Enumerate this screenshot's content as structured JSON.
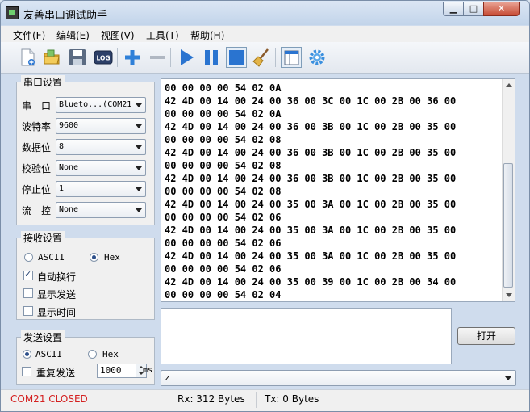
{
  "window": {
    "title": "友善串口调试助手",
    "app_icon": "terminal-icon"
  },
  "window_controls": {
    "minimize": "▁",
    "maximize": "□",
    "close": "✕"
  },
  "menu": [
    "文件(F)",
    "编辑(E)",
    "视图(V)",
    "工具(T)",
    "帮助(H)"
  ],
  "toolbar": {
    "icons": [
      "new-file-icon",
      "open-folder-icon",
      "save-icon",
      "log-icon",
      "add-icon",
      "remove-icon",
      "play-icon",
      "pause-icon",
      "stop-icon",
      "broom-icon",
      "layout-icon",
      "gear-icon"
    ],
    "log_label": "LOG"
  },
  "serial_settings": {
    "title": "串口设置",
    "fields": [
      {
        "label": "串　口",
        "value": "Blueto...(COM21"
      },
      {
        "label": "波特率",
        "value": "9600"
      },
      {
        "label": "数据位",
        "value": "8"
      },
      {
        "label": "校验位",
        "value": "None"
      },
      {
        "label": "停止位",
        "value": "1"
      },
      {
        "label": "流　控",
        "value": "None"
      }
    ]
  },
  "receive_settings": {
    "title": "接收设置",
    "ascii": "ASCII",
    "hex": "Hex",
    "selected": "Hex",
    "options": [
      {
        "label": "自动换行",
        "checked": true
      },
      {
        "label": "显示发送",
        "checked": false
      },
      {
        "label": "显示时间",
        "checked": false
      }
    ]
  },
  "send_settings": {
    "title": "发送设置",
    "ascii": "ASCII",
    "hex": "Hex",
    "selected": "ASCII",
    "repeat_label": "重复发送",
    "repeat_checked": false,
    "interval": "1000",
    "unit": "ms"
  },
  "receive_buffer": [
    "00 00 00 00 54 02 0A",
    "42 4D 00 14 00 24 00 36 00 3C 00 1C 00 2B 00 36 00",
    "00 00 00 00 54 02 0A",
    "42 4D 00 14 00 24 00 36 00 3B 00 1C 00 2B 00 35 00",
    "00 00 00 00 54 02 08",
    "42 4D 00 14 00 24 00 36 00 3B 00 1C 00 2B 00 35 00",
    "00 00 00 00 54 02 08",
    "42 4D 00 14 00 24 00 36 00 3B 00 1C 00 2B 00 35 00",
    "00 00 00 00 54 02 08",
    "42 4D 00 14 00 24 00 35 00 3A 00 1C 00 2B 00 35 00",
    "00 00 00 00 54 02 06",
    "42 4D 00 14 00 24 00 35 00 3A 00 1C 00 2B 00 35 00",
    "00 00 00 00 54 02 06",
    "42 4D 00 14 00 24 00 35 00 3A 00 1C 00 2B 00 35 00",
    "00 00 00 00 54 02 06",
    "42 4D 00 14 00 24 00 35 00 39 00 1C 00 2B 00 34 00",
    "00 00 00 00 54 02 04"
  ],
  "send_input": "",
  "open_button": "打开",
  "send_history": {
    "value": "z"
  },
  "status": {
    "port": "COM21 CLOSED",
    "port_color": "#d42020",
    "rx": "Rx: 312 Bytes",
    "tx": "Tx: 0 Bytes"
  }
}
